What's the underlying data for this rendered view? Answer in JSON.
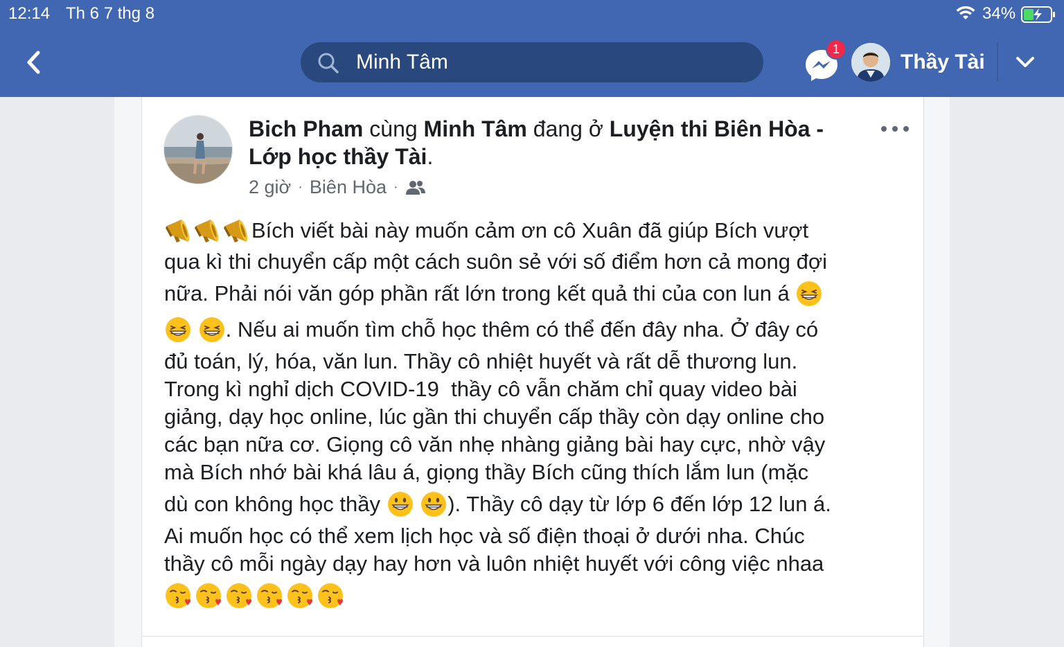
{
  "status_bar": {
    "time": "12:14",
    "date": "Th 6 7 thg 8",
    "battery": "34%"
  },
  "navbar": {
    "search_value": "Minh Tâm",
    "messenger_badge": "1",
    "profile_name": "Thầy Tài"
  },
  "post": {
    "author": "Bich Pham",
    "with_word": " cùng ",
    "tagged": "Minh Tâm",
    "at_word": " đang ở ",
    "place_line1": "Luyện thi Biên Hòa -",
    "place_line2": "Lớp học thầy Tài",
    "period": ".",
    "time_ago": "2 giờ",
    "location": "Biên Hòa",
    "lines": [
      "Bích viết bài này muốn cảm ơn cô Xuân đã giúp Bích vượt",
      "qua kì thi chuyển cấp một cách suôn sẻ với số điểm hơn cả mong đợi",
      "nữa. Phải nói văn góp phần rất lớn trong kết quả thi của con lun á",
      ". Nếu ai muốn tìm chỗ học thêm có thể đến đây nha. Ở đây có",
      "đủ toán, lý, hóa, văn lun. Thầy cô nhiệt huyết và rất dễ thương lun.",
      "Trong kì nghỉ dịch COVID-19  thầy cô vẫn chăm chỉ quay video bài",
      "giảng, dạy học online, lúc gần thi chuyển cấp thầy còn dạy online cho",
      "các bạn nữa cơ. Giọng cô văn nhẹ nhàng giảng bài hay cực, nhờ vậy",
      "mà Bích nhớ bài khá lâu á, giọng thầy Bích cũng thích lắm lun (mặc",
      "dù con không học thầy ",
      "). Thầy cô dạy từ lớp 6 đến lớp 12 lun á.",
      "Ai muốn học có thể xem lịch học và số điện thoại ở dưới nha. Chúc",
      "thầy cô mỗi ngày dạy hay hơn và luôn nhiệt huyết với công việc nhaa"
    ]
  },
  "colors": {
    "brand_blue": "#4267b2",
    "search_bg": "#29487d",
    "badge_red": "#f02849",
    "meta_gray": "#606770"
  },
  "icons": {
    "back": "chevron-left-icon",
    "search": "search-icon",
    "messenger": "messenger-icon",
    "dropdown": "chevron-down-icon",
    "more": "more-dots-icon",
    "audience": "friends-icon",
    "megaphone": "megaphone-emoji",
    "grin": "grinning-squint-emoji",
    "smile": "grinning-emoji",
    "kiss": "kissing-heart-emoji"
  }
}
